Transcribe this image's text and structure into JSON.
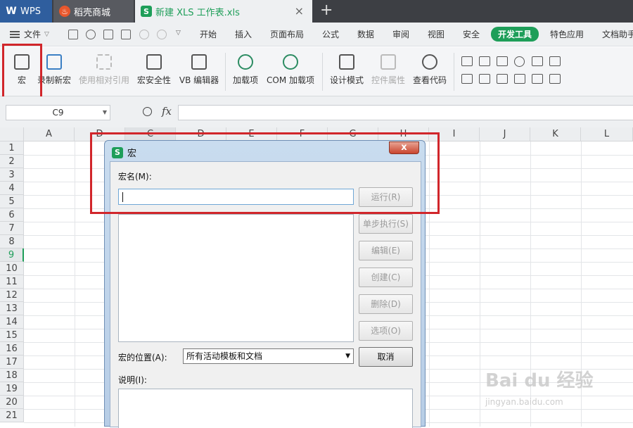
{
  "tabs": {
    "wps": {
      "logo": "W",
      "label": "WPS"
    },
    "daoke": {
      "logo": "♨",
      "label": "稻壳商城"
    },
    "doc": {
      "logo": "S",
      "label": "新建 XLS 工作表.xls",
      "close": "×"
    },
    "add": "+"
  },
  "menu": {
    "file": "文件",
    "items": [
      "开始",
      "插入",
      "页面布局",
      "公式",
      "数据",
      "审阅",
      "视图",
      "安全",
      "开发工具",
      "特色应用",
      "文档助手"
    ],
    "active": "开发工具"
  },
  "ribbon": {
    "buttons": [
      {
        "label": "宏",
        "icon": "macro-icon",
        "enabled": true
      },
      {
        "label": "录制新宏",
        "icon": "record-macro-icon",
        "enabled": true
      },
      {
        "label": "使用相对引用",
        "icon": "relative-ref-icon",
        "enabled": false
      },
      {
        "label": "宏安全性",
        "icon": "macro-security-icon",
        "enabled": true
      },
      {
        "label": "VB 编辑器",
        "icon": "vb-editor-icon",
        "enabled": true
      },
      {
        "label": "加载项",
        "icon": "addin-icon",
        "enabled": true
      },
      {
        "label": "COM 加载项",
        "icon": "com-addin-icon",
        "enabled": true
      },
      {
        "label": "设计模式",
        "icon": "design-mode-icon",
        "enabled": true
      },
      {
        "label": "控件属性",
        "icon": "control-properties-icon",
        "enabled": false
      },
      {
        "label": "查看代码",
        "icon": "view-code-icon",
        "enabled": true
      }
    ]
  },
  "formula": {
    "name_box": "C9",
    "fx": "fx",
    "value": ""
  },
  "sheet": {
    "columns": [
      "A",
      "D",
      "C",
      "D",
      "E",
      "F",
      "G",
      "H",
      "I",
      "J",
      "K",
      "L"
    ],
    "selected_column": "C",
    "rows": [
      "1",
      "2",
      "3",
      "4",
      "5",
      "6",
      "7",
      "8",
      "9",
      "10",
      "11",
      "12",
      "13",
      "14",
      "15",
      "16",
      "17",
      "18",
      "19",
      "20",
      "21"
    ],
    "selected_row": "9"
  },
  "dialog": {
    "logo": "S",
    "title": "宏",
    "close": "x",
    "macro_name_label": "宏名(M):",
    "macro_name_value": "",
    "buttons": {
      "run": "运行(R)",
      "step": "单步执行(S)",
      "edit": "编辑(E)",
      "create": "创建(C)",
      "delete": "删除(D)",
      "options": "选项(O)",
      "cancel": "取消"
    },
    "location_label": "宏的位置(A):",
    "location_value": "所有活动模板和文档",
    "description_label": "说明(I):"
  },
  "watermark": {
    "main": "Bai du 经验",
    "sub": "jingyan.baidu.com"
  },
  "colors": {
    "accent": "#1e9e59",
    "highlight_box": "#d1262b",
    "titlebar": "#3d3f44"
  }
}
